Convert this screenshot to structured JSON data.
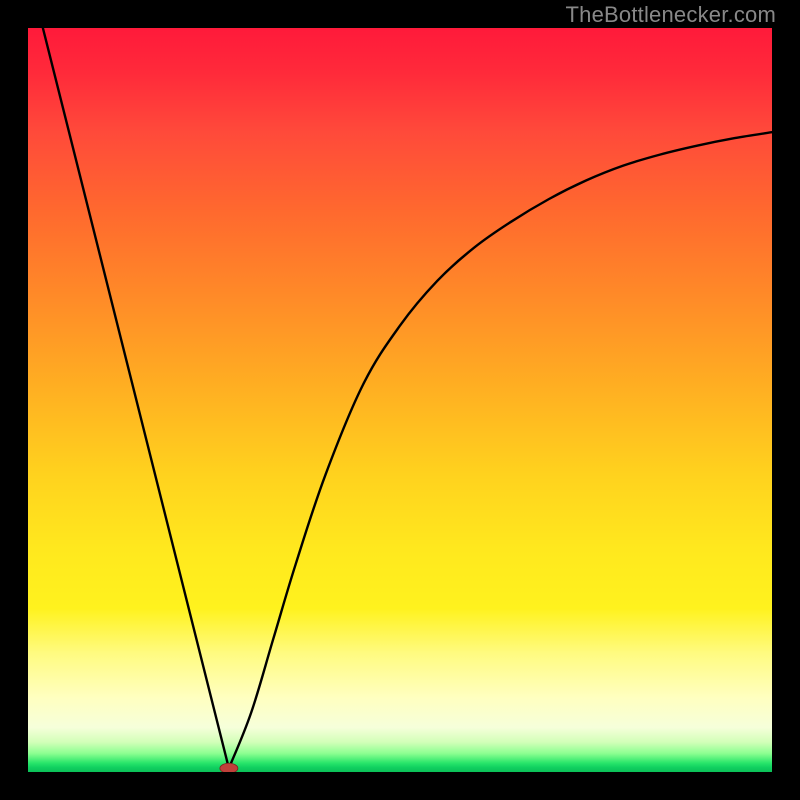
{
  "watermark": "TheBottlenecker.com",
  "colors": {
    "page_bg": "#000000",
    "curve_stroke": "#000000",
    "minimum_marker": "#c0403a",
    "gradient_top": "#ff1a3a",
    "gradient_bottom": "#0cc058"
  },
  "chart_data": {
    "type": "line",
    "title": "",
    "xlabel": "",
    "ylabel": "",
    "xlim": [
      0,
      100
    ],
    "ylim": [
      0,
      100
    ],
    "grid": false,
    "series": [
      {
        "name": "left-branch",
        "comment": "Straight descending segment from top-left toward the minimum",
        "x": [
          2,
          27
        ],
        "y": [
          100,
          0.5
        ]
      },
      {
        "name": "right-branch",
        "comment": "Curve rising from the minimum toward upper right, flattening out",
        "x": [
          27,
          30,
          33,
          36,
          40,
          45,
          50,
          55,
          60,
          65,
          70,
          75,
          80,
          85,
          90,
          95,
          100
        ],
        "y": [
          0.5,
          8,
          18,
          28,
          40,
          52,
          60,
          66,
          70.5,
          74,
          77,
          79.5,
          81.5,
          83,
          84.2,
          85.2,
          86
        ]
      }
    ],
    "minimum": {
      "x": 27,
      "y": 0.5
    },
    "annotations": []
  }
}
